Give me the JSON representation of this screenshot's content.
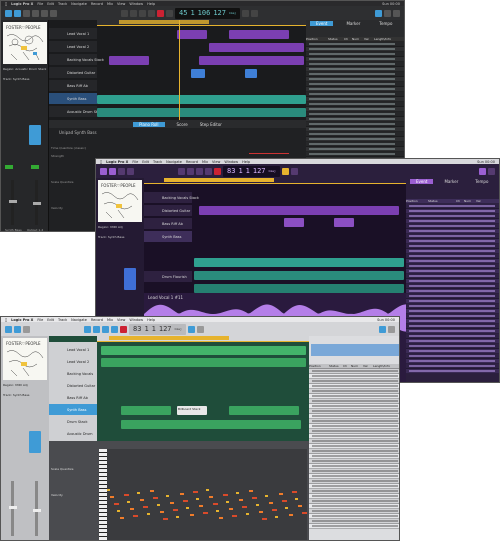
{
  "menu": {
    "apple": "",
    "app": "Logic Pro X",
    "items": [
      "File",
      "Edit",
      "Track",
      "Navigate",
      "Record",
      "Mix",
      "View",
      "Window",
      "?",
      "Help"
    ],
    "clock_top": "Sun 00:00",
    "clock_mid": "Sun 00:00",
    "clock_bot": "Sun 00:00"
  },
  "lcd": {
    "top": {
      "bar": "45",
      "beat": "1",
      "tempo": "106",
      "sig": "127",
      "key": "Cmaj"
    },
    "mid": {
      "bar": "83",
      "beat": "1",
      "tempo": "1",
      "sig": "127",
      "key": "Cmaj"
    },
    "bot": {
      "bar": "83",
      "beat": "1",
      "tempo": "1",
      "sig": "127",
      "key": "Cmaj"
    }
  },
  "album": {
    "brand": "FOSTER the PEOPLE"
  },
  "top_window": {
    "tracks": [
      "Lead Vocal 1",
      "Lead Vocal 2",
      "Backing Vocals Stack",
      "Distorted Guitar",
      "Bass Riff Ab",
      "Synth Bass",
      "Acoustic Drum Stack"
    ],
    "region_label": "Region: Acoustic Drum Stack",
    "inspector_title": "Track: Synth Bass",
    "editor_tabs": [
      "Piano Roll",
      "Score",
      "Step Editor"
    ],
    "right_tabs": [
      "Event",
      "Marker",
      "Tempo"
    ],
    "list_headers": [
      "Position",
      "Status",
      "Ch",
      "Num",
      "Val",
      "Length/Info"
    ],
    "track_list_title": "Unipad Synth Bass",
    "brush_label": "Time Quantize (classic)",
    "strength_label": "Strength",
    "scale_label": "Scale Quantize",
    "velocity_label": "Velocity",
    "channel_label": "Synth Bass",
    "bus_label": "Output 1-2"
  },
  "mid_window": {
    "tracks": [
      "Backing Vocals Stack",
      "Distorted Guitar",
      "Bass Riff Ab",
      "Synth Bass",
      "Drum Flourish"
    ],
    "region_label": "Region: MIDI Adj",
    "inspector_title": "Track: Synth Bass",
    "right_tabs": [
      "Event",
      "Marker",
      "Tempo"
    ],
    "list_headers": [
      "Position",
      "Status",
      "Ch",
      "Num",
      "Val"
    ],
    "audio_title": "Lead Vocal 1 #11",
    "event_names": [
      "Note",
      "Control",
      "Pitch Bend",
      "Note",
      "Note",
      "Note",
      "Note",
      "Note",
      "Note",
      "Note",
      "Note",
      "Note",
      "Note",
      "Note",
      "Note",
      "Note",
      "Note",
      "Note",
      "Note",
      "Note",
      "Note",
      "Note",
      "Note",
      "Note",
      "Note",
      "Note",
      "Note",
      "Note",
      "Note",
      "Note",
      "Note",
      "Note",
      "Note",
      "Note"
    ],
    "event_notes": [
      "C3",
      "D3",
      "E3",
      "G2",
      "A2",
      "C3",
      "D3",
      "E3",
      "G3",
      "F3",
      "C3",
      "E3",
      "G3",
      "A3",
      "C4",
      "D3",
      "E3",
      "G2",
      "C3",
      "D3",
      "E3",
      "G3",
      "A3",
      "C3",
      "F2",
      "C3",
      "D3",
      "E3",
      "G3",
      "C3",
      "A2",
      "D3",
      "E3",
      "G3"
    ]
  },
  "bot_window": {
    "tracks": [
      "Lead Vocal 1",
      "Lead Vocal 2",
      "Backing Vocals",
      "Distorted Guitar",
      "Bass Riff Ab",
      "Synth Bass",
      "Drum Stack",
      "Acoustic Drum"
    ],
    "region_label": "Region: MIDI Adj",
    "inspector_title": "Track: Synth Bass",
    "list_headers": [
      "Position",
      "Status",
      "Ch",
      "Num",
      "Val",
      "Length/Info"
    ],
    "highlight_region": "Billboard Stack",
    "scale_label": "Scale Quantize",
    "velocity_label": "Velocity"
  },
  "colors": {
    "accent_blue": "#3f9bd6",
    "lcd_teal": "#6cc7c9",
    "purple": "#7b3fb2",
    "teal_region": "#2fa08f",
    "green_region": "#43b36a",
    "yellow_ruler": "#e6b32e"
  }
}
